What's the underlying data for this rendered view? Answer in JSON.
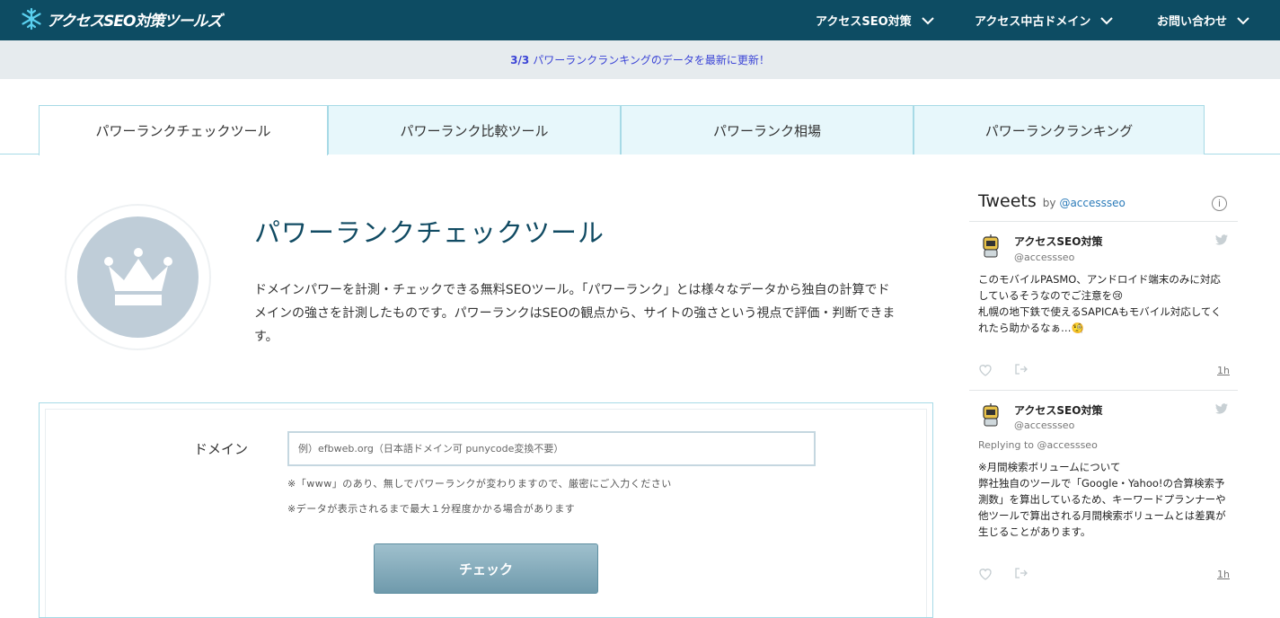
{
  "header": {
    "logo_text": "アクセスSEO対策ツールズ",
    "nav": [
      {
        "label": "アクセスSEO対策"
      },
      {
        "label": "アクセス中古ドメイン"
      },
      {
        "label": "お問い合わせ"
      }
    ]
  },
  "announce": {
    "count": "3/3",
    "prefix": "パワーランク",
    "link_text": "ランキングのデータを最新",
    "suffix": "に更新！"
  },
  "tabs": [
    {
      "label": "パワーランクチェックツール"
    },
    {
      "label": "パワーランク比較ツール"
    },
    {
      "label": "パワーランク相場"
    },
    {
      "label": "パワーランクランキング"
    }
  ],
  "intro": {
    "title": "パワーランクチェックツール",
    "description": "ドメインパワーを計測・チェックできる無料SEOツール。「パワーランク」とは様々なデータから独自の計算でドメインの強さを計測したものです。パワーランクはSEOの観点から、サイトの強さという視点で評価・判断できます。"
  },
  "form": {
    "label": "ドメイン",
    "placeholder": "例）efbweb.org（日本語ドメイン可 punycode変換不要）",
    "note1": "※「www」のあり、無しでパワーランクが変わりますので、厳密にご入力ください",
    "note2": "※データが表示されるまで最大１分程度かかる場合があります",
    "button": "チェック"
  },
  "tweets_widget": {
    "title": "Tweets",
    "by": "by",
    "handle": "@accessseo",
    "info": "i",
    "tweets": [
      {
        "name": "アクセスSEO対策",
        "user": "@accessseo",
        "reply": "",
        "text": "このモバイルPASMO、アンドロイド端末のみに対応しているそうなのでご注意を😢\n札幌の地下鉄で使えるSAPICAもモバイル対応してくれたら助かるなぁ…🧐",
        "time": "1h"
      },
      {
        "name": "アクセスSEO対策",
        "user": "@accessseo",
        "reply": "Replying to @accessseo",
        "text": "※月間検索ボリュームについて\n弊社独自のツールで「Google・Yahoo!の合算検索予測数」を算出しているため、キーワードプランナーや他ツールで算出される月間検索ボリュームとは差異が生じることがあります。",
        "time": "1h"
      }
    ]
  },
  "colors": {
    "header_bg": "#0d4c63",
    "announce_bg": "#e6ebee",
    "announce_text": "#3b44d6",
    "tab_bg": "#e7f7fb",
    "tab_border": "#a7dae6",
    "title": "#114b63",
    "badge": "#bfcdd8",
    "button": "#7fa6b6",
    "link": "#2b7bb9"
  },
  "icons": {
    "logo": "snowflake-logo-icon",
    "nav_chevron": "chevron-down-icon",
    "badge": "crown-icon",
    "info": "info-icon",
    "tweet_bird": "twitter-bird-icon",
    "like": "heart-icon",
    "share": "share-icon"
  }
}
